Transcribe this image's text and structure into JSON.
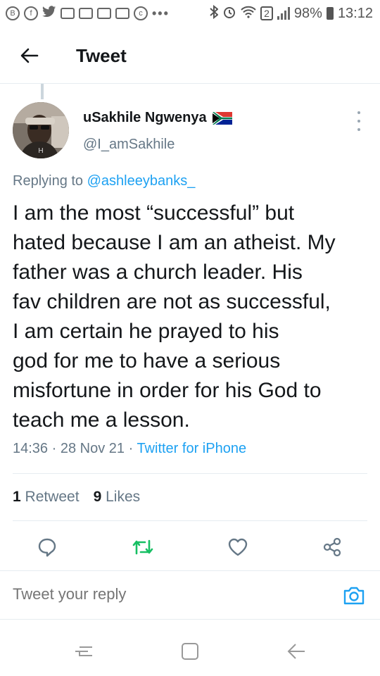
{
  "status_bar": {
    "battery": "98%",
    "time": "13:12",
    "notification_count": "2"
  },
  "header": {
    "title": "Tweet"
  },
  "tweet": {
    "author_name": "uSakhile Ngwenya",
    "handle": "@I_amSakhile",
    "replying_prefix": "Replying to",
    "replying_to": "@ashleeybanks_",
    "text_lines": [
      "I am the most “successful” but",
      "hated because I am an atheist. My",
      "father was a church leader. His",
      "fav children are not as successful,",
      "I am certain he prayed to his",
      "god for me to have a serious",
      "misfortune in order for his God to",
      "teach me a lesson."
    ],
    "time": "14:36",
    "date": "28 Nov 21",
    "source": "Twitter for iPhone",
    "retweets": "1",
    "retweets_label": "Retweet",
    "likes": "9",
    "likes_label": "Likes"
  },
  "reply": {
    "placeholder": "Tweet your reply"
  },
  "colors": {
    "accent": "#1da1f2",
    "retweet_green": "#17bf63",
    "secondary_text": "#657786"
  },
  "icons": {
    "back": "arrow-left-icon",
    "more": "more-vertical-icon",
    "reply": "reply-icon",
    "retweet": "retweet-icon",
    "like": "heart-icon",
    "share": "share-icon",
    "camera": "camera-icon"
  }
}
